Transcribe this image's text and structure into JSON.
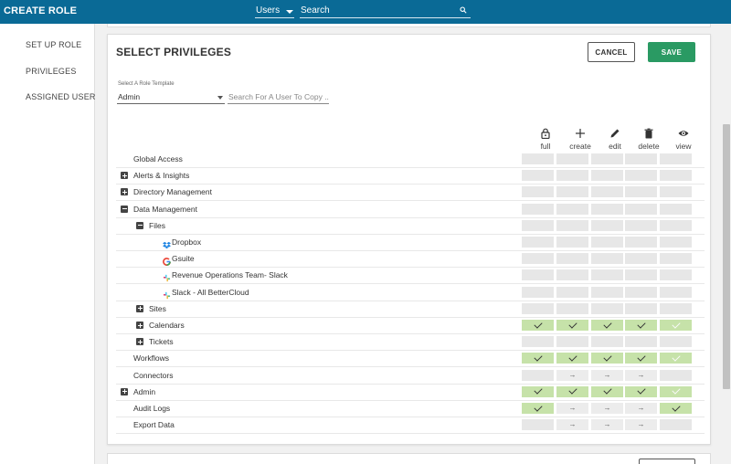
{
  "header": {
    "app_title": "CREATE ROLE",
    "scope_select_value": "Users",
    "search_placeholder": "Search"
  },
  "leftnav": {
    "items": [
      {
        "label": "SET UP ROLE"
      },
      {
        "label": "PRIVILEGES"
      },
      {
        "label": "ASSIGNED USERS"
      }
    ]
  },
  "panel": {
    "title": "SELECT PRIVILEGES",
    "cancel_label": "CANCEL",
    "save_label": "SAVE",
    "template_label": "Select A Role Template",
    "template_value": "Admin",
    "copy_user_placeholder": "Search For A User To Copy ..."
  },
  "columns": [
    {
      "label": "full",
      "icon": "lock-icon"
    },
    {
      "label": "create",
      "icon": "plus-icon"
    },
    {
      "label": "edit",
      "icon": "pencil-icon"
    },
    {
      "label": "delete",
      "icon": "trash-icon"
    },
    {
      "label": "view",
      "icon": "eye-icon"
    }
  ],
  "rows": [
    {
      "label": "Global Access",
      "level": 0,
      "expander": "none",
      "perms": [
        "off",
        "off",
        "off",
        "off",
        "off"
      ]
    },
    {
      "label": "Alerts & Insights",
      "level": 0,
      "expander": "plus",
      "perms": [
        "off",
        "off",
        "off",
        "off",
        "off"
      ]
    },
    {
      "label": "Directory Management",
      "level": 0,
      "expander": "plus",
      "perms": [
        "off",
        "off",
        "off",
        "off",
        "off"
      ]
    },
    {
      "label": "Data Management",
      "level": 0,
      "expander": "minus",
      "perms": [
        "off",
        "off",
        "off",
        "off",
        "off"
      ]
    },
    {
      "label": "Files",
      "level": 1,
      "expander": "minus",
      "perms": [
        "off",
        "off",
        "off",
        "off",
        "off"
      ]
    },
    {
      "label": "Dropbox",
      "level": 2,
      "expander": "none",
      "icon": "dropbox-icon",
      "perms": [
        "off",
        "off",
        "off",
        "off",
        "off"
      ]
    },
    {
      "label": "Gsuite",
      "level": 2,
      "expander": "none",
      "icon": "google-icon",
      "perms": [
        "off",
        "off",
        "off",
        "off",
        "off"
      ]
    },
    {
      "label": "Revenue Operations Team- Slack",
      "level": 2,
      "expander": "none",
      "icon": "slack-icon",
      "perms": [
        "off",
        "off",
        "off",
        "off",
        "off"
      ]
    },
    {
      "label": "Slack - All BetterCloud",
      "level": 2,
      "expander": "none",
      "icon": "slack-icon",
      "perms": [
        "off",
        "off",
        "off",
        "off",
        "off"
      ]
    },
    {
      "label": "Sites",
      "level": 1,
      "expander": "plus",
      "perms": [
        "off",
        "off",
        "off",
        "off",
        "off"
      ]
    },
    {
      "label": "Calendars",
      "level": 1,
      "expander": "plus",
      "perms": [
        "check",
        "check",
        "check",
        "check",
        "check-light"
      ]
    },
    {
      "label": "Tickets",
      "level": 1,
      "expander": "plus",
      "perms": [
        "off",
        "off",
        "off",
        "off",
        "off"
      ]
    },
    {
      "label": "Workflows",
      "level": 0,
      "expander": "none",
      "perms": [
        "check",
        "check",
        "check",
        "check",
        "check-light"
      ]
    },
    {
      "label": "Connectors",
      "level": 0,
      "expander": "none",
      "perms": [
        "off",
        "arrow",
        "arrow",
        "arrow",
        "off"
      ]
    },
    {
      "label": "Admin",
      "level": 0,
      "expander": "plus",
      "perms": [
        "check",
        "check",
        "check",
        "check",
        "check-light"
      ]
    },
    {
      "label": "Audit Logs",
      "level": 0,
      "expander": "none",
      "perms": [
        "check",
        "arrow",
        "arrow",
        "arrow",
        "check"
      ]
    },
    {
      "label": "Export Data",
      "level": 0,
      "expander": "none",
      "perms": [
        "off",
        "arrow",
        "arrow",
        "arrow",
        "off"
      ]
    }
  ],
  "colors": {
    "topbar": "#0a6a96",
    "save_button": "#2a9a63",
    "permission_on": "#c6e2a9",
    "permission_off": "#e7e7e7"
  }
}
